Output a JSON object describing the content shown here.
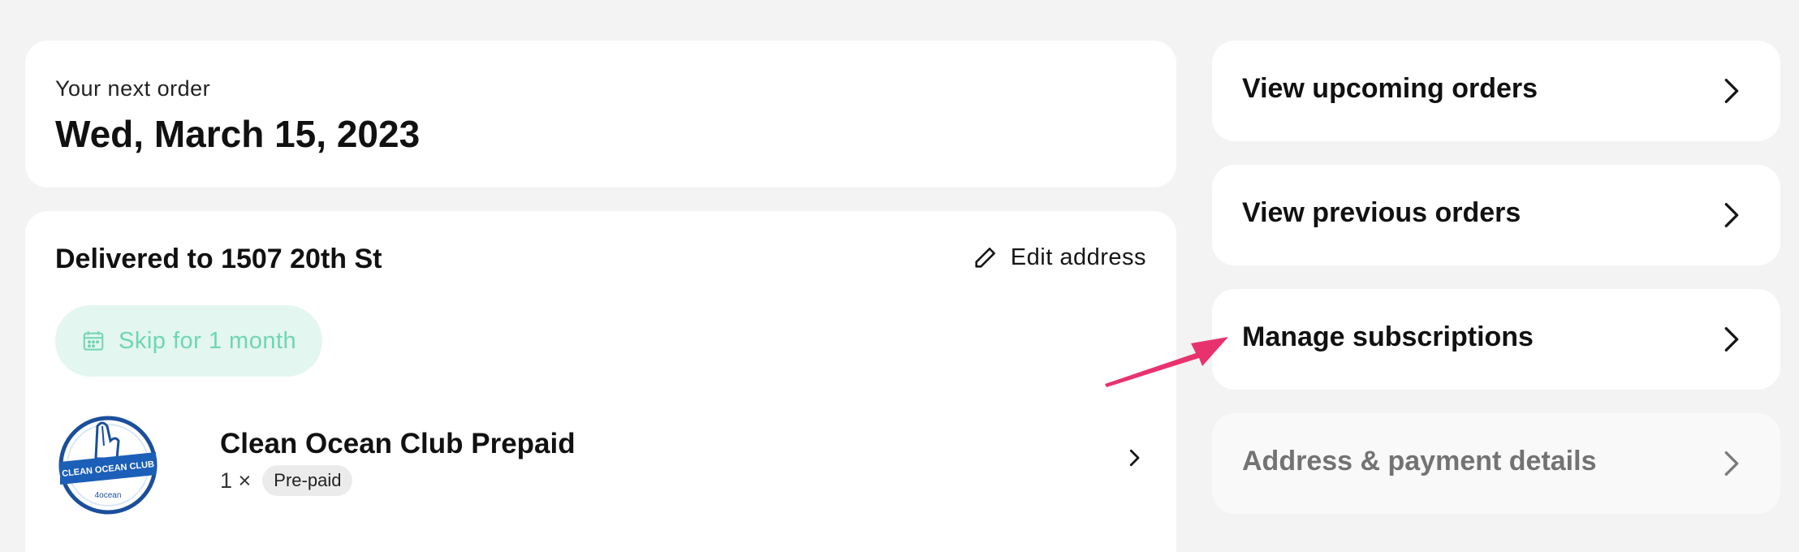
{
  "next_order": {
    "eyebrow": "Your next order",
    "date": "Wed, March 15, 2023"
  },
  "delivery": {
    "title": "Delivered to 1507 20th St",
    "edit_label": "Edit address",
    "skip_label": "Skip for 1 month",
    "product": {
      "name": "Clean Ocean Club Prepaid",
      "quantity": "1 ×",
      "badge": "Pre-paid",
      "logo_text": "CLEAN OCEAN CLUB",
      "logo_sub": "4ocean"
    }
  },
  "nav": {
    "upcoming": "View upcoming orders",
    "previous": "View previous orders",
    "subscriptions": "Manage subscriptions",
    "address_payment": "Address & payment details"
  },
  "colors": {
    "accent_green": "#6fd6b3",
    "arrow_pink": "#e8326e"
  }
}
